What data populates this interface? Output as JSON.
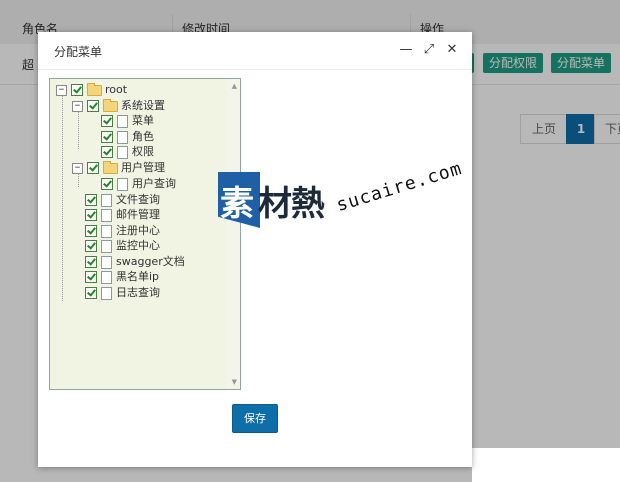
{
  "background": {
    "columns": [
      "角色名",
      "修改时间",
      "操作"
    ],
    "row_text": "超",
    "buttons": [
      "分配权限",
      "分配菜单"
    ],
    "pager": {
      "prev": "上页",
      "current": "1",
      "next": "下页"
    }
  },
  "dialog": {
    "title": "分配菜单",
    "controls": {
      "minimize": "—",
      "maximize": "⤢",
      "close": "✕"
    },
    "tree": {
      "root": "root",
      "nodes": [
        "系统设置",
        "菜单",
        "角色",
        "权限",
        "用户管理",
        "用户查询",
        "文件查询",
        "邮件管理",
        "注册中心",
        "监控中心",
        "swagger文档",
        "黑名单ip",
        "日志查询"
      ]
    },
    "save_label": "保存"
  },
  "watermark": {
    "logo": "素",
    "text": "材熱",
    "url": "sucaire.com"
  }
}
